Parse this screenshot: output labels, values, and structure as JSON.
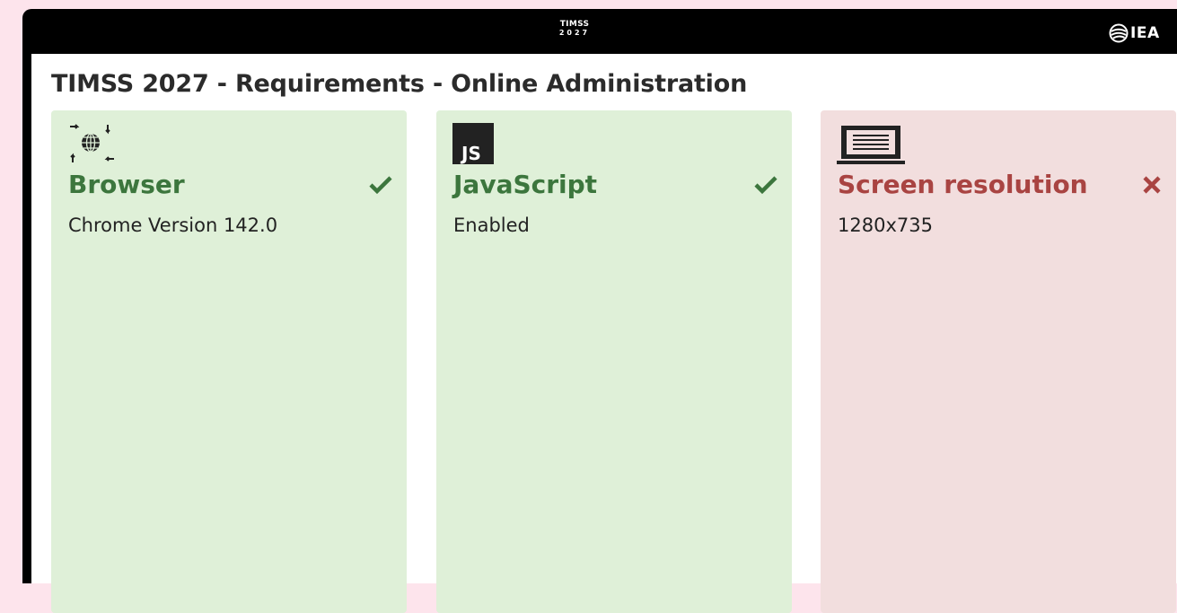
{
  "header": {
    "brand_line1": "TIMSS",
    "brand_line2": "2027",
    "iea_label": "IEA"
  },
  "page": {
    "title": "TIMSS 2027 - Requirements - Online Administration"
  },
  "colors": {
    "pass_bg": "#dff0d8",
    "pass_text": "#3c763d",
    "fail_bg": "#f2dede",
    "fail_text": "#a94442",
    "page_bg": "#fde4ec"
  },
  "requirements": [
    {
      "title": "Browser",
      "value": "Chrome Version 142.0",
      "status": "pass",
      "icon": "globe-arrows-icon"
    },
    {
      "title": "JavaScript",
      "value": "Enabled",
      "status": "pass",
      "icon": "js-icon"
    },
    {
      "title": "Screen resolution",
      "value": "1280x735",
      "status": "fail",
      "icon": "laptop-icon"
    }
  ]
}
